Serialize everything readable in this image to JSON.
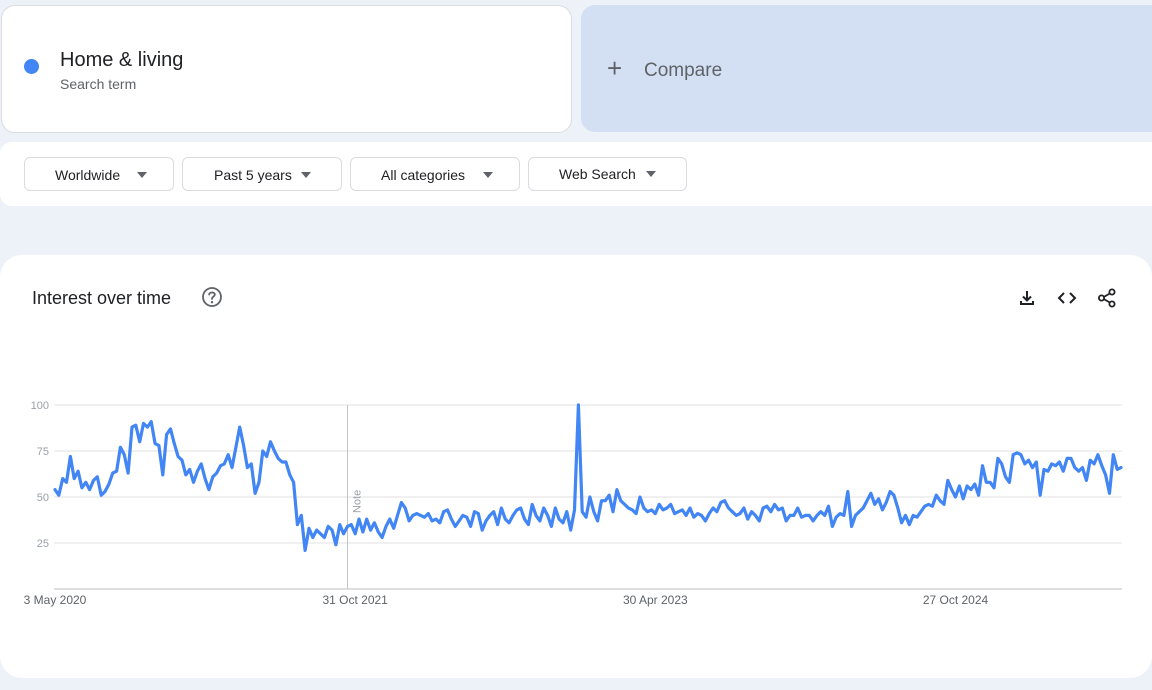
{
  "search_term": {
    "name": "Home & living",
    "type_label": "Search term",
    "color": "#4285f4"
  },
  "compare": {
    "plus": "+",
    "label": "Compare"
  },
  "filters": {
    "region": "Worldwide",
    "time_range": "Past 5 years",
    "category": "All categories",
    "property": "Web Search"
  },
  "chart_panel": {
    "title": "Interest over time",
    "icons": [
      "help-icon",
      "download-icon",
      "embed-icon",
      "share-icon"
    ]
  },
  "chart_data": {
    "type": "line",
    "title": "Interest over time",
    "xlabel": "",
    "ylabel": "",
    "ylim": [
      0,
      100
    ],
    "yticks": [
      25,
      50,
      75,
      100
    ],
    "grid": true,
    "x_tick_labels": [
      "3 May 2020",
      "31 Oct 2021",
      "30 Apr 2023",
      "27 Oct 2024"
    ],
    "x_tick_positions": [
      0,
      78,
      156,
      234
    ],
    "annotation": {
      "label": "Note",
      "week": 76
    },
    "series": [
      {
        "color": "#4285f4",
        "values": [
          54,
          51,
          60,
          58,
          72,
          60,
          64,
          55,
          58,
          54,
          59,
          61,
          51,
          53,
          57,
          63,
          64,
          77,
          73,
          63,
          88,
          89,
          80,
          90,
          88,
          91,
          79,
          78,
          62,
          84,
          87,
          79,
          72,
          70,
          62,
          65,
          58,
          64,
          68,
          60,
          54,
          61,
          63,
          67,
          68,
          73,
          66,
          77,
          88,
          78,
          66,
          68,
          52,
          58,
          75,
          72,
          80,
          75,
          71,
          69,
          69,
          62,
          58,
          35,
          40,
          21,
          33,
          28,
          32,
          30,
          28,
          34,
          32,
          24,
          35,
          30,
          34,
          35,
          30,
          38,
          31,
          38,
          32,
          36,
          31,
          28,
          34,
          38,
          33,
          40,
          47,
          44,
          37,
          40,
          41,
          40,
          39,
          41,
          37,
          38,
          36,
          42,
          43,
          38,
          34,
          37,
          40,
          39,
          34,
          42,
          41,
          32,
          37,
          40,
          42,
          35,
          44,
          38,
          36,
          40,
          43,
          44,
          38,
          35,
          46,
          40,
          37,
          44,
          40,
          34,
          44,
          38,
          36,
          42,
          32,
          43,
          100,
          42,
          39,
          50,
          42,
          37,
          48,
          48,
          51,
          42,
          54,
          48,
          46,
          44,
          43,
          41,
          50,
          44,
          42,
          43,
          41,
          46,
          43,
          44,
          46,
          41,
          42,
          43,
          40,
          44,
          39,
          41,
          40,
          37,
          41,
          44,
          42,
          47,
          48,
          44,
          42,
          40,
          41,
          44,
          38,
          42,
          40,
          37,
          44,
          45,
          42,
          46,
          43,
          44,
          37,
          40,
          40,
          44,
          39,
          40,
          40,
          37,
          40,
          42,
          40,
          45,
          34,
          39,
          41,
          40,
          53,
          34,
          40,
          42,
          44,
          48,
          52,
          46,
          49,
          43,
          47,
          53,
          51,
          44,
          36,
          40,
          35,
          40,
          39,
          42,
          45,
          46,
          45,
          51,
          48,
          46,
          59,
          54,
          50,
          56,
          49,
          56,
          54,
          57,
          51,
          67,
          58,
          58,
          55,
          71,
          68,
          61,
          58,
          73,
          74,
          73,
          68,
          70,
          66,
          69,
          51,
          65,
          64,
          68,
          67,
          69,
          64,
          71,
          71,
          66,
          64,
          66,
          59,
          70,
          68,
          73,
          67,
          62,
          52,
          73,
          65,
          66
        ]
      }
    ]
  }
}
